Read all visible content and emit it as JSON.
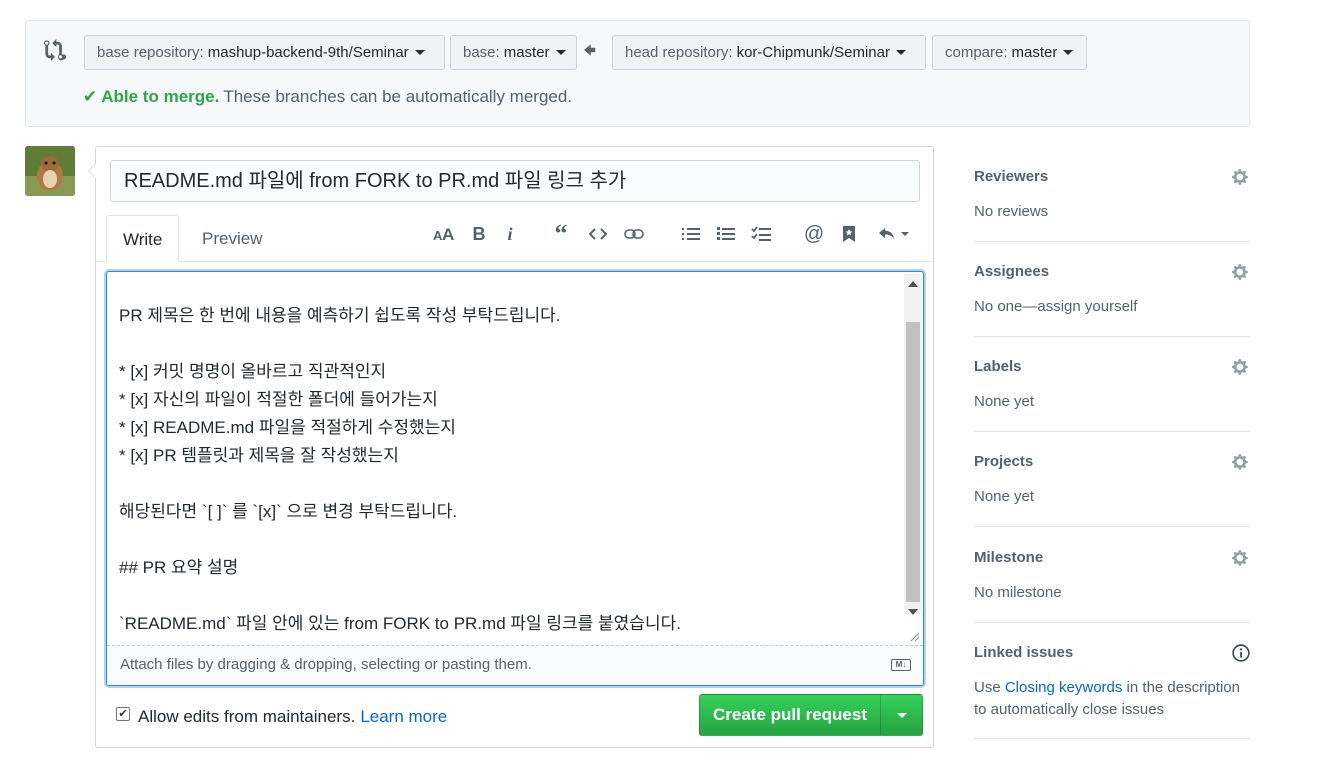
{
  "compare": {
    "base_repo_key": "base repository:",
    "base_repo_value": "mashup-backend-9th/Seminar",
    "base_key": "base:",
    "base_value": "master",
    "head_repo_key": "head repository:",
    "head_repo_value": "kor-Chipmunk/Seminar",
    "compare_key": "compare:",
    "compare_value": "master",
    "merge_ok": "Able to merge.",
    "merge_msg": "These branches can be automatically merged."
  },
  "form": {
    "title_value": "README.md 파일에 from FORK to PR.md 파일 링크 추가",
    "tabs": [
      "Write",
      "Preview"
    ],
    "toolbar_icons": [
      "header-icon",
      "bold-icon",
      "italic-icon",
      "quote-icon",
      "code-icon",
      "link-icon",
      "unordered-list-icon",
      "ordered-list-icon",
      "task-list-icon",
      "mention-icon",
      "saved-reply-icon",
      "reply-icon"
    ],
    "body_lines": [
      "PR 제목은 한 번에 내용을 예측하기 쉽도록 작성 부탁드립니다.",
      "",
      "* [x] 커밋 명명이 올바르고 직관적인지",
      "* [x] 자신의 파일이 적절한 폴더에 들어가는지",
      "* [x] README.md 파일을 적절하게 수정했는지",
      "* [x] PR 템플릿과 제목을 잘 작성했는지",
      "",
      "해당된다면 `[ ]` 를 `[x]` 으로 변경 부탁드립니다.",
      "",
      "## PR 요약 설명",
      "",
      "`README.md` 파일 안에 있는 from FORK to PR.md 파일 링크를 붙였습니다."
    ],
    "drop_hint": "Attach files by dragging & dropping, selecting or pasting them.",
    "markdown_badge": "M↓",
    "allow_edits_label": "Allow edits from maintainers.",
    "learn_more": "Learn more",
    "create_button": "Create pull request"
  },
  "sidebar": [
    {
      "title": "Reviewers",
      "value": "No reviews",
      "icon": "gear-icon"
    },
    {
      "title": "Assignees",
      "value": "No one—assign yourself",
      "icon": "gear-icon"
    },
    {
      "title": "Labels",
      "value": "None yet",
      "icon": "gear-icon"
    },
    {
      "title": "Projects",
      "value": "None yet",
      "icon": "gear-icon"
    },
    {
      "title": "Milestone",
      "value": "No milestone",
      "icon": "gear-icon"
    },
    {
      "title": "Linked issues",
      "value_pre": "Use ",
      "value_link": "Closing keywords",
      "value_post": " in the description",
      "value_line2": "to automatically close issues",
      "icon": "info-icon"
    }
  ],
  "colors": {
    "accent_green": "#28a745",
    "link_blue": "#0366d6",
    "focus_blue": "#2188ff"
  }
}
